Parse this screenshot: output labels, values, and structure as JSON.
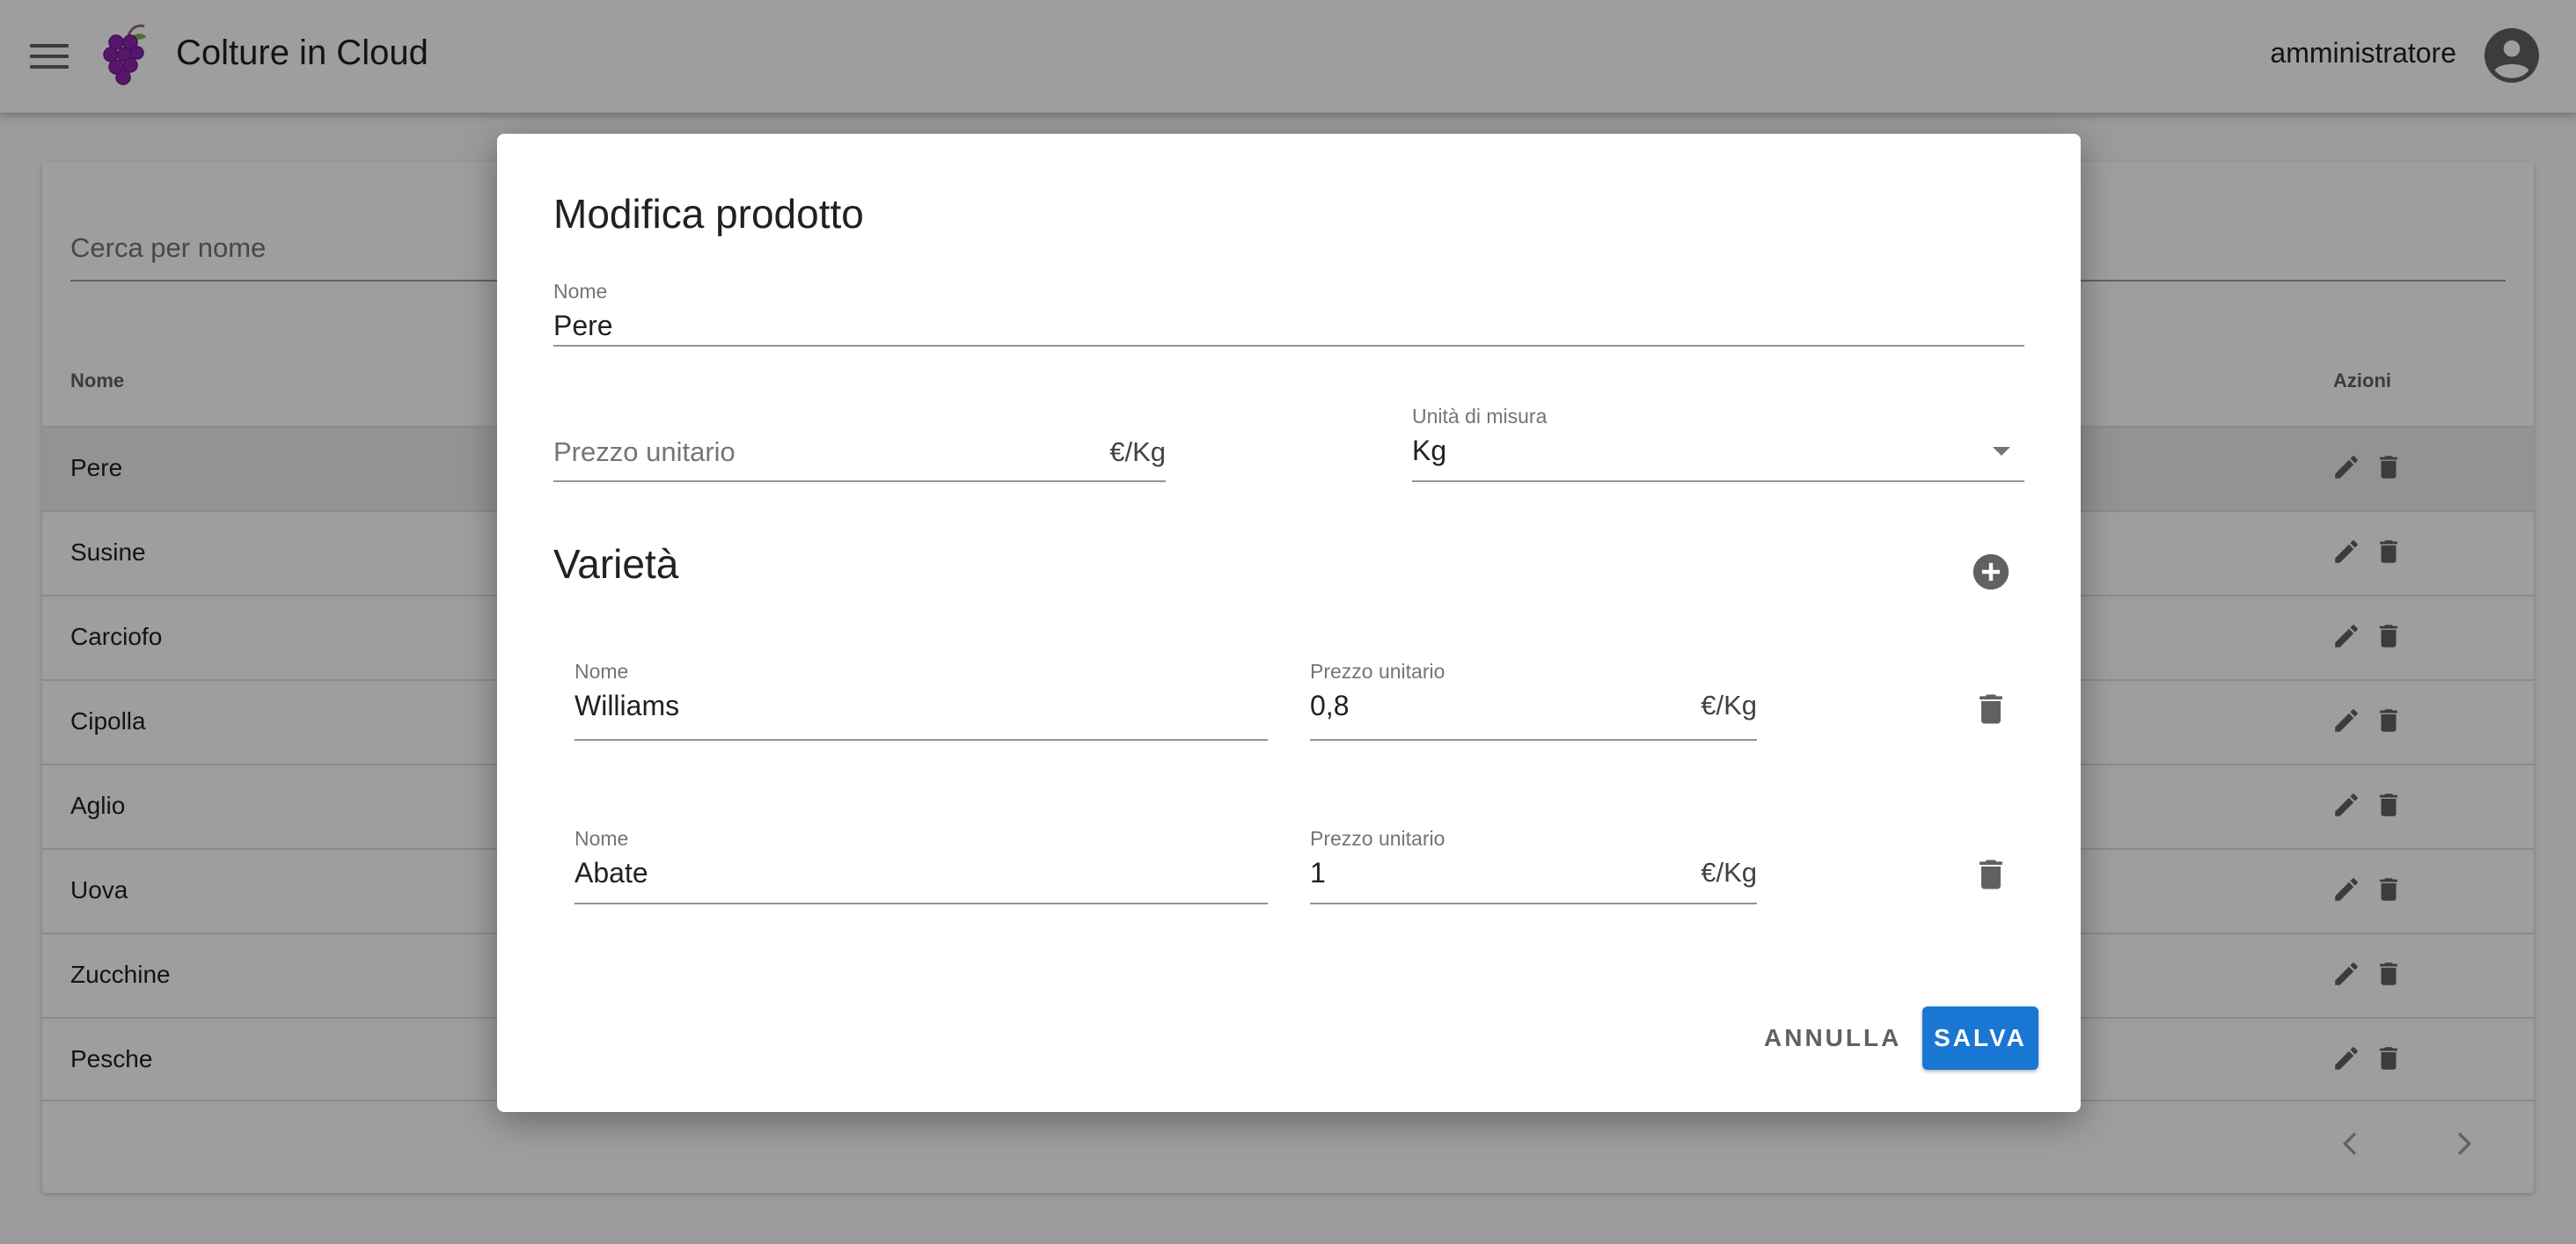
{
  "app": {
    "title": "Colture in Cloud",
    "username": "amministratore"
  },
  "list": {
    "search_placeholder": "Cerca per nome",
    "columns": {
      "name": "Nome",
      "actions": "Azioni"
    },
    "rows": [
      "Pere",
      "Susine",
      "Carciofo",
      "Cipolla",
      "Aglio",
      "Uova",
      "Zucchine",
      "Pesche"
    ],
    "selected_row": "Pere"
  },
  "dialog": {
    "title": "Modifica prodotto",
    "name_label": "Nome",
    "name_value": "Pere",
    "price_placeholder": "Prezzo unitario",
    "price_suffix": "€/Kg",
    "unit_label": "Unità di misura",
    "unit_value": "Kg",
    "varieties_title": "Varietà",
    "varieties": [
      {
        "name_label": "Nome",
        "name_value": "Williams",
        "price_label": "Prezzo unitario",
        "price_value": "0,8",
        "price_suffix": "€/Kg"
      },
      {
        "name_label": "Nome",
        "name_value": "Abate",
        "price_label": "Prezzo unitario",
        "price_value": "1",
        "price_suffix": "€/Kg"
      }
    ],
    "cancel_label": "ANNULLA",
    "save_label": "SALVA"
  },
  "colors": {
    "primary": "#1976d2",
    "scrim": "rgba(0,0,0,0.38)"
  },
  "icons": [
    "menu-icon",
    "grapes-logo-icon",
    "account-circle-icon",
    "pencil-icon",
    "trash-icon",
    "add-circle-icon",
    "chevron-left-icon",
    "chevron-right-icon",
    "dropdown-caret-icon"
  ]
}
